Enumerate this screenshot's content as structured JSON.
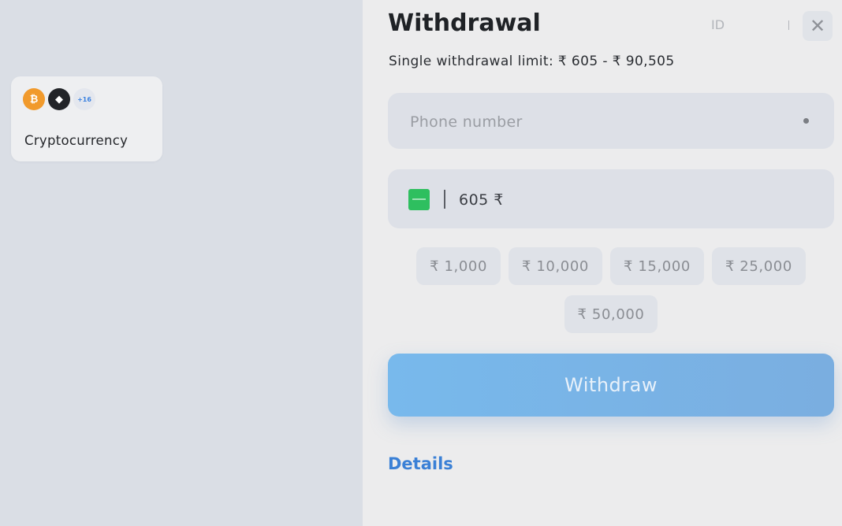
{
  "methods": [
    {
      "label": "Cryptocurrency",
      "icons": [
        {
          "name": "bitcoin-icon",
          "glyph": "₿"
        },
        {
          "name": "ethereum-icon",
          "glyph": "◆"
        }
      ],
      "more_badge": "+16"
    }
  ],
  "header": {
    "title": "Withdrawal",
    "id_label": "ID",
    "close_glyph": "✕"
  },
  "limit_text": "Single withdrawal limit: ₹ 605 - ₹ 90,505",
  "phone_field": {
    "placeholder": "Phone number",
    "value": ""
  },
  "amount_field": {
    "value": "605 ₹"
  },
  "presets": [
    "₹ 1,000",
    "₹ 10,000",
    "₹ 15,000",
    "₹ 25,000",
    "₹ 50,000"
  ],
  "withdraw_button": "Withdraw",
  "details_link": "Details",
  "colors": {
    "accent": "#3a80d6",
    "button": "#78b9ec",
    "payment_icon": "#2ebf5f"
  }
}
